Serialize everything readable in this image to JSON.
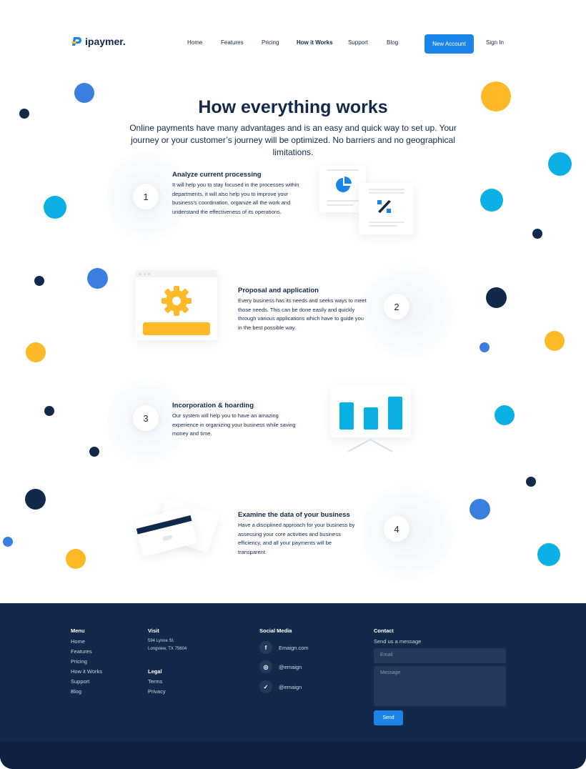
{
  "brand": {
    "name": "ipaymer."
  },
  "nav": {
    "items": [
      "Home",
      "Features",
      "Pricing",
      "How it Works",
      "Support",
      "Blog"
    ],
    "active": "How it Works",
    "new_account": "New Account",
    "sign_in": "Sign In"
  },
  "hero": {
    "title": "How everything works",
    "subtitle": "Online payments have many advantages and is an easy and quick way to set up. Your journey or your customer’s journey will be optimized.  No barriers and no geographical limitations."
  },
  "steps": [
    {
      "number": "1",
      "title": "Analyze current processing",
      "text": "It will help you to stay focused in the processes within departments, it will also help you to improve your business's coordination, organize all the work and understand the effectiveness of its operations.",
      "illustration": "pie-chart-percent-icon"
    },
    {
      "number": "2",
      "title": "Proposal and application",
      "text": "Every business has its needs and seeks ways to meet those needs. This can be done easily and quickly through various applications which have to guide you in the best possible way.",
      "illustration": "gear-icon"
    },
    {
      "number": "3",
      "title": "Incorporation & hoarding",
      "text": "Our system will help you to have an amazing experience in organizing your business while saving money and time.",
      "illustration": "bar-chart-icon"
    },
    {
      "number": "4",
      "title": "Examine the data of your business",
      "text": "Have a disciplined approach for your business by assessing your core activities and business efficiency, and all your payments will be transparent.",
      "illustration": "credit-card-icon"
    }
  ],
  "footer": {
    "menu": {
      "heading": "Menu",
      "items": [
        "Home",
        "Features",
        "Pricing",
        "How it Works",
        "Support",
        "Blog"
      ]
    },
    "visit": {
      "heading": "Visit",
      "address_line1": "594 Lynne St.",
      "address_line2": "Longview, TX 75604"
    },
    "legal": {
      "heading": "Legal",
      "items": [
        "Terms",
        "Privacy"
      ]
    },
    "social": {
      "heading": "Social Media",
      "items": [
        {
          "icon": "facebook-icon",
          "glyph": "f",
          "label": "Emaign.com"
        },
        {
          "icon": "instagram-icon",
          "glyph": "◎",
          "label": "@emaign"
        },
        {
          "icon": "twitter-icon",
          "glyph": "✓",
          "label": "@emaign"
        }
      ]
    },
    "contact": {
      "heading": "Contact",
      "subheading": "Send us a message",
      "email_placeholder": "Email",
      "message_placeholder": "Message",
      "send_label": "Send"
    }
  },
  "colors": {
    "navy": "#13294b",
    "blue": "#1b84e8",
    "cyan": "#0ab0e4",
    "yellow": "#fdb927",
    "dot_blue": "#3a7fe0"
  }
}
